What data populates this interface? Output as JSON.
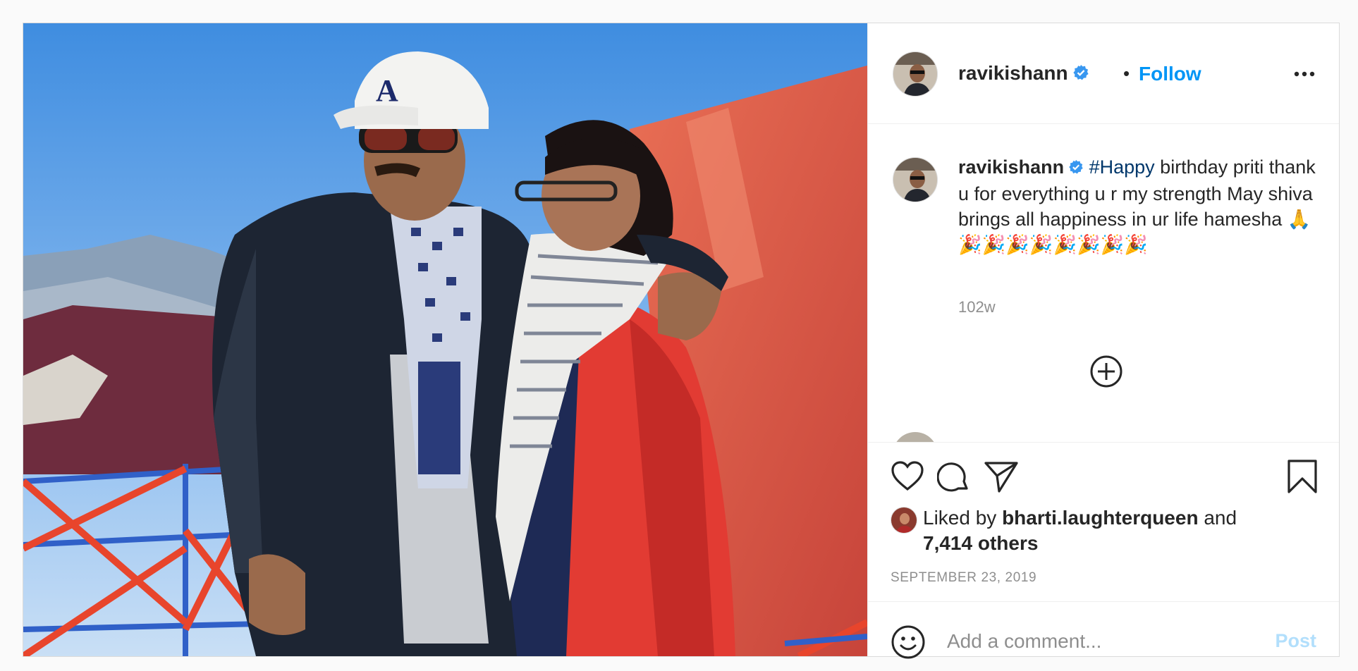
{
  "post": {
    "author": {
      "username": "ravikishann",
      "verified": true
    },
    "follow_label": "Follow",
    "separator": "•",
    "caption": {
      "username": "ravikishann",
      "hashtag": "#Happy",
      "text": " birthday priti thank u for everything u r my strength May shiva brings all happiness in ur life hamesha 🙏🎉🎉🎉🎉🎉🎉🎉🎉",
      "time": "102w"
    },
    "likes": {
      "prefix": "Liked by ",
      "user": "bharti.laughterqueen",
      "middle": " and",
      "others": "7,414 others"
    },
    "date": "SEPTEMBER 23, 2019",
    "comment_input": {
      "placeholder": "Add a comment..."
    },
    "post_button": "Post"
  },
  "icons": {
    "verified": "verified-badge-icon",
    "more": "more-options-icon",
    "load_more": "load-more-comments-icon",
    "like": "heart-icon",
    "comment": "comment-icon",
    "share": "share-icon",
    "save": "bookmark-icon",
    "emoji": "emoji-icon"
  },
  "colors": {
    "link": "#0095f6",
    "hashtag": "#00376b",
    "muted": "#8e8e8e",
    "post_disabled": "#b2dffc"
  }
}
